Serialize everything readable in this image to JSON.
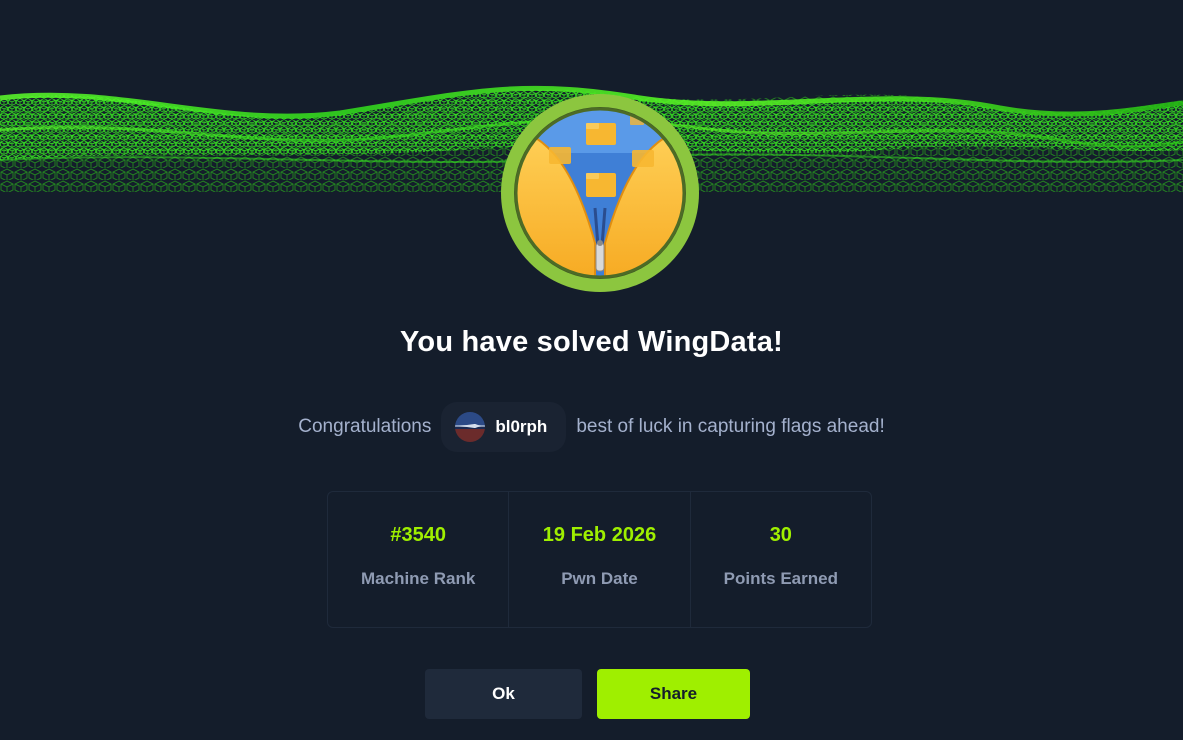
{
  "modal": {
    "title": "You have solved WingData!",
    "congrats_prefix": "Congratulations",
    "congrats_suffix": "best of luck in capturing flags ahead!",
    "user": {
      "name": "bl0rph",
      "avatar_icon": "user-avatar-image"
    },
    "badge_icon": "machine-badge-zipper-folders",
    "banner_icon": "green-cube-wave-banner"
  },
  "stats": [
    {
      "value": "#3540",
      "label": "Machine Rank"
    },
    {
      "value": "19 Feb 2026",
      "label": "Pwn Date"
    },
    {
      "value": "30",
      "label": "Points Earned"
    }
  ],
  "buttons": {
    "ok_label": "Ok",
    "share_label": "Share"
  },
  "colors": {
    "background": "#141d2b",
    "accent_green": "#9fef00",
    "panel": "#1f2a3b",
    "muted_text": "#a4b1cd"
  }
}
